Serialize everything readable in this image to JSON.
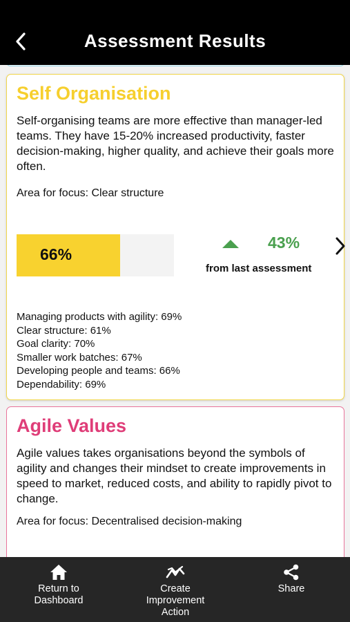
{
  "header": {
    "title": "Assessment Results"
  },
  "cards": [
    {
      "title": "Self Organisation",
      "description": "Self-organising teams are more effective than manager-led teams. They have 15-20% increased productivity, faster decision-making, higher quality, and achieve their goals more often.",
      "focus": "Area for focus: Clear structure",
      "score_label": "66%",
      "score": 66,
      "change_label": "43%",
      "change_caption": "from last assessment",
      "metrics": [
        "Managing products with agility: 69%",
        "Clear structure: 61%",
        "Goal clarity: 70%",
        "Smaller work batches: 67%",
        "Developing people and teams: 66%",
        "Dependability: 69%"
      ],
      "accent": "#f6cf2e"
    },
    {
      "title": "Agile Values",
      "description": "Agile values takes organisations beyond the symbols of agility and changes their mindset to create improvements in speed to market, reduced costs, and ability to rapidly pivot to change.",
      "focus": "Area for focus: Decentralised decision-making",
      "accent": "#df3d78"
    }
  ],
  "tabbar": {
    "home_label": "Return to\nDashboard",
    "improve_label": "Create\nImprovement\nAction",
    "share_label": "Share",
    "icons": [
      "home-icon",
      "trend-icon",
      "share-icon"
    ]
  },
  "colors": {
    "header_bg": "#000000",
    "tabbar_bg": "#262626",
    "positive": "#4aa04e",
    "progress_fill": "#f8d22f"
  }
}
